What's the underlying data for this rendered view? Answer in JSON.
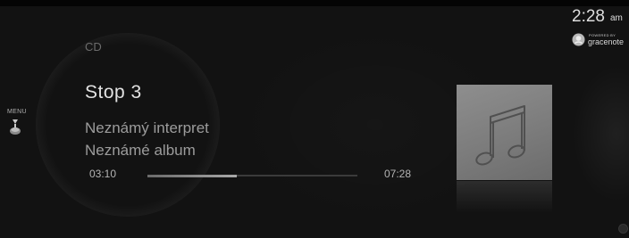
{
  "clock": {
    "time": "2:28",
    "ampm": "am"
  },
  "gracenote": {
    "powered_by": "POWERED BY",
    "brand": "gracenote",
    "icon": "gracenote-logo-icon"
  },
  "sidebar": {
    "menu_label": "MENU",
    "menu_icon": "commander-knob-down-icon"
  },
  "player": {
    "source": "CD",
    "track_title": "Stop 3",
    "artist": "Neznámý interpret",
    "album": "Neznámé album",
    "elapsed": "03:10",
    "duration": "07:28",
    "progress": 0.424
  },
  "album_art": {
    "icon": "music-note-icon"
  },
  "colors": {
    "background": "#121212",
    "primary_text": "#e2e2e2",
    "secondary_text": "#9c9c9c",
    "progress_fill": "#a8a8a8",
    "progress_track": "#3b3b3b",
    "album_art": "#8e8e8e"
  }
}
